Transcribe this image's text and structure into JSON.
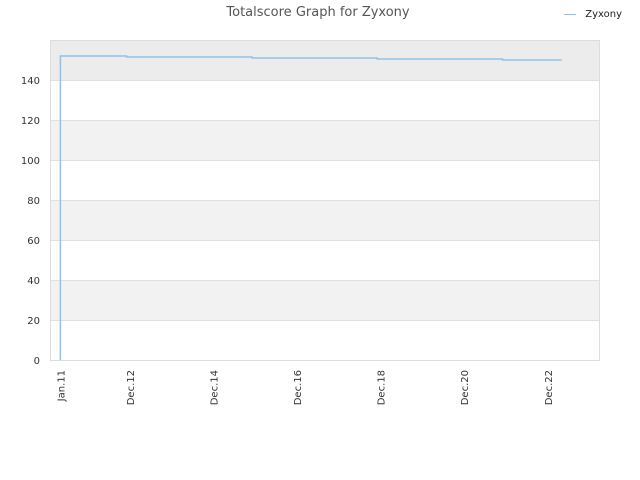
{
  "chart_data": {
    "type": "line",
    "title": "Totalscore Graph for Zyxony",
    "xlabel": "",
    "ylabel": "",
    "x_tick_labels": [
      "Jan.11",
      "Dec.12",
      "Dec.14",
      "Dec.16",
      "Dec.18",
      "Dec.20",
      "Dec.22"
    ],
    "x_range": [
      "2011-01",
      "2024-03"
    ],
    "y_ticks": [
      0,
      20,
      40,
      60,
      80,
      100,
      120,
      140
    ],
    "ylim": [
      0,
      160
    ],
    "grid": "horizontal bands",
    "legend_position": "top-right",
    "series": [
      {
        "name": "Zyxony",
        "color": "#8fc1ee",
        "step": true,
        "points": [
          {
            "x": "2011-04",
            "y": 0
          },
          {
            "x": "2011-04",
            "y": 152
          },
          {
            "x": "2012-11",
            "y": 152
          },
          {
            "x": "2012-11",
            "y": 151.5
          },
          {
            "x": "2015-11",
            "y": 151.5
          },
          {
            "x": "2015-11",
            "y": 151
          },
          {
            "x": "2018-11",
            "y": 151
          },
          {
            "x": "2018-11",
            "y": 150.5
          },
          {
            "x": "2021-11",
            "y": 150.5
          },
          {
            "x": "2021-11",
            "y": 150
          },
          {
            "x": "2023-04",
            "y": 150
          }
        ]
      }
    ]
  },
  "colors": {
    "band_light": "#f2f2f2",
    "band_top": "#ececec",
    "grid_line": "#e0e0e0",
    "axis_text": "#333333"
  }
}
